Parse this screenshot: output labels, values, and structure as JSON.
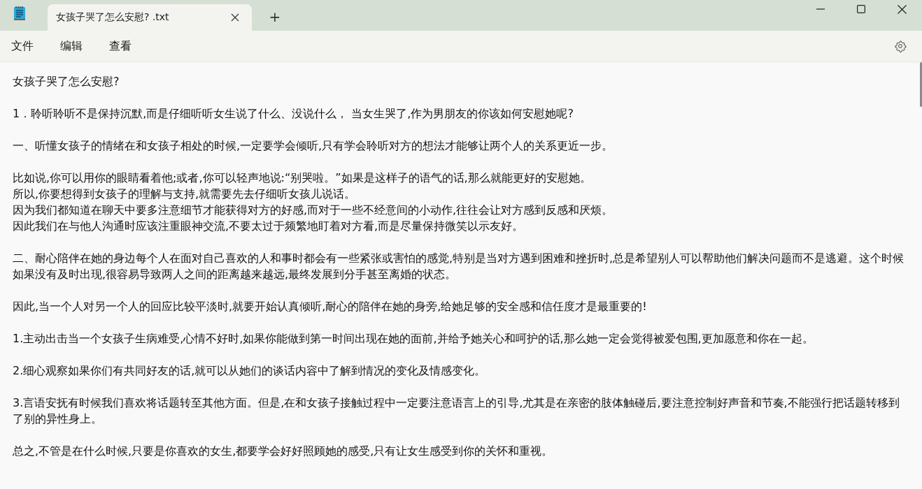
{
  "window": {
    "tabs": [
      {
        "title": "女孩子哭了怎么安慰? .txt",
        "selected": true
      }
    ],
    "new_tab": "+"
  },
  "menu": [
    "文件",
    "编辑",
    "查看"
  ],
  "document": {
    "paragraphs": [
      [
        "女孩子哭了怎么安慰?"
      ],
      [
        "1．聆听聆听不是保持沉默,而是仔细听听女生说了什么、没说什么， 当女生哭了,作为男朋友的你该如何安慰她呢?"
      ],
      [
        "一、听懂女孩子的情绪在和女孩子相处的时候,一定要学会倾听,只有学会聆听对方的想法才能够让两个人的关系更近一步。"
      ],
      [
        "比如说,你可以用你的眼睛看着他;或者,你可以轻声地说:“别哭啦。”如果是这样子的语气的话,那么就能更好的安慰她。",
        "所以,你要想得到女孩子的理解与支持,就需要先去仔细听女孩儿说话。",
        "因为我们都知道在聊天中要多注意细节才能获得对方的好感,而对于一些不经意间的小动作,往往会让对方感到反感和厌烦。",
        "因此我们在与他人沟通时应该注重眼神交流,不要太过于频繁地盯着对方看,而是尽量保持微笑以示友好。"
      ],
      [
        "二、耐心陪伴在她的身边每个人在面对自己喜欢的人和事时都会有一些紧张或害怕的感觉,特别是当对方遇到困难和挫折时,总是希望别人可以帮助他们解决问题而不是逃避。这个时候如果没有及时出现,很容易导致两人之间的距离越来越远,最终发展到分手甚至离婚的状态。"
      ],
      [
        "因此,当一个人对另一个人的回应比较平淡时,就要开始认真倾听,耐心的陪伴在她的身旁,给她足够的安全感和信任度才是最重要的!"
      ],
      [
        "1.主动出击当一个女孩子生病难受,心情不好时,如果你能做到第一时间出现在她的面前,并给予她关心和呵护的话,那么她一定会觉得被爱包围,更加愿意和你在一起。"
      ],
      [
        "2.细心观察如果你们有共同好友的话,就可以从她们的谈话内容中了解到情况的变化及情感变化。"
      ],
      [
        "3.言语安抚有时候我们喜欢将话题转至其他方面。但是,在和女孩子接触过程中一定要注意语言上的引导,尤其是在亲密的肢体触碰后,要注意控制好声音和节奏,不能强行把话题转移到了别的异性身上。"
      ],
      [
        "总之,不管是在什么时候,只要是你喜欢的女生,都要学会好好照顾她的感受,只有让女生感受到你的关怀和重视。"
      ]
    ]
  }
}
